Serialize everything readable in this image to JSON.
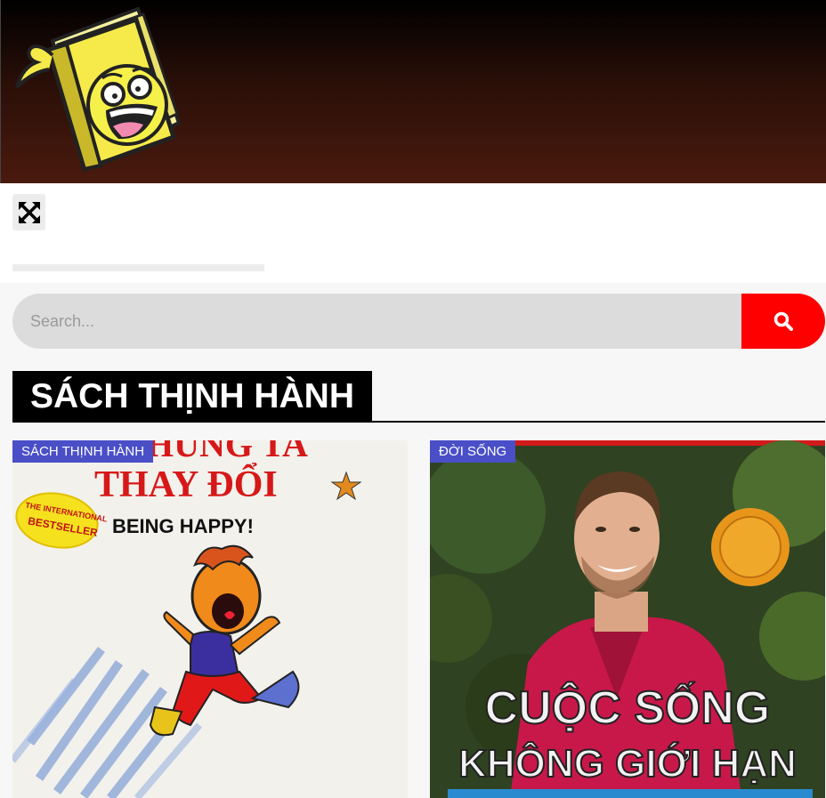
{
  "header": {
    "logo_icon": "book-mascot-logo-icon"
  },
  "nav": {
    "expand_icon": "expand-icon"
  },
  "search": {
    "placeholder": "Search...",
    "button_icon": "search-icon",
    "button_color": "#ff0000"
  },
  "section": {
    "title": "SÁCH THỊNH HÀNH"
  },
  "cards": [
    {
      "category": "SÁCH THỊNH HÀNH",
      "cover_title_top": "HÚNG TA",
      "cover_title": "THAY ĐỔI",
      "cover_subtitle": "BEING HAPPY!",
      "cover_seal": "THE INTERNATIONAL BESTSELLER"
    },
    {
      "category": "ĐỜI SỐNG",
      "cover_title": "CUỘC SỐNG",
      "cover_subtitle": "KHÔNG GIỚI HẠN"
    }
  ],
  "colors": {
    "badge": "#4a4fc7",
    "accent": "#ff0000",
    "header_bottom": "#4a1a0e"
  }
}
